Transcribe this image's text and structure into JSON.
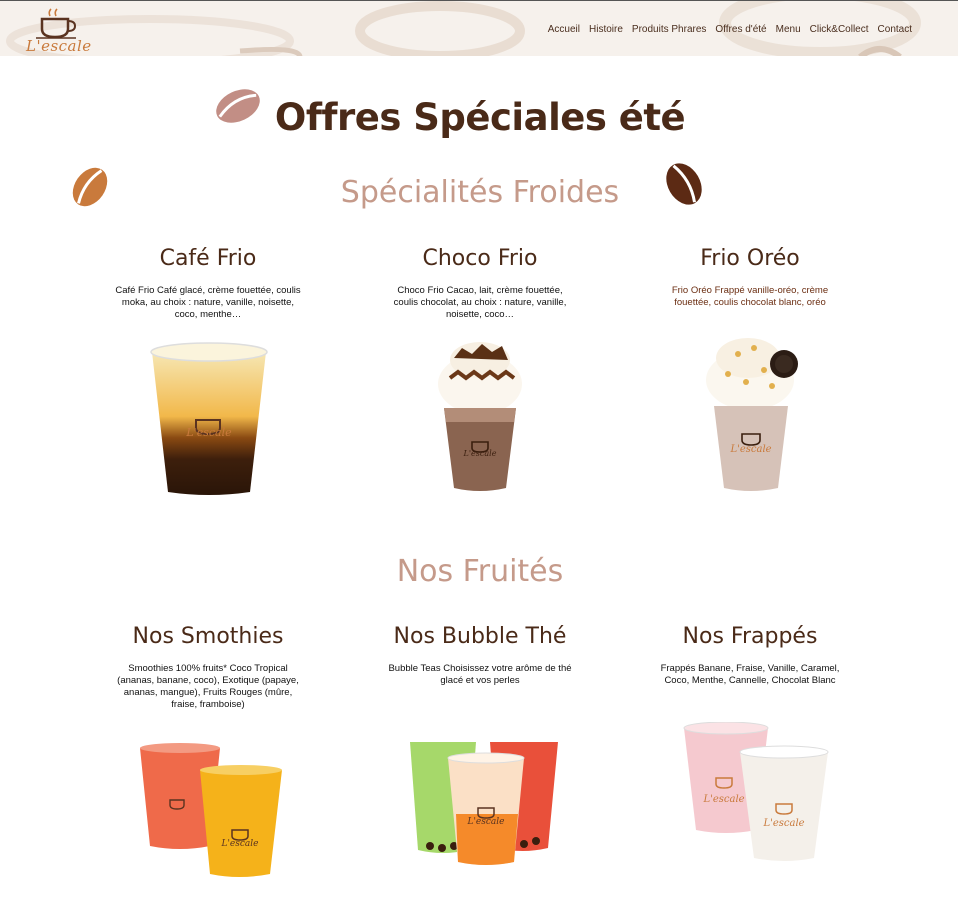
{
  "header": {
    "logo_text": "L'escale",
    "nav": [
      "Accueil",
      "Histoire",
      "Produits Phrares",
      "Offres d'été",
      "Menu",
      "Click&Collect",
      "Contact"
    ]
  },
  "page_title": "Offres Spéciales été",
  "sections": [
    {
      "title": "Spécialités Froides",
      "products": [
        {
          "name": "Café Frio",
          "desc": "Café Frio Café glacé, crème fouettée, coulis moka, au choix : nature, vanille, noisette, coco, menthe…"
        },
        {
          "name": "Choco Frio",
          "desc": "Choco Frio Cacao, lait, crème fouettée, coulis chocolat, au choix : nature, vanille, noisette, coco…"
        },
        {
          "name": "Frio Oréo",
          "desc": "Frio Oréo Frappé vanille-oréo, crème fouettée, coulis chocolat blanc, oréo"
        }
      ]
    },
    {
      "title": "Nos Fruités",
      "products": [
        {
          "name": "Nos Smothies",
          "desc": "Smoothies 100% fruits* Coco Tropical (ananas, banane, coco), Exotique (papaye, ananas, mangue), Fruits Rouges (mûre, fraise, framboise)"
        },
        {
          "name": "Nos Bubble Thé",
          "desc": "Bubble Teas Choisissez votre arôme de thé glacé et vos perles"
        },
        {
          "name": "Nos Frappés",
          "desc": "Frappés Banane, Fraise, Vanille, Caramel, Coco, Menthe, Cannelle, Chocolat Blanc"
        }
      ]
    }
  ],
  "colors": {
    "title_brown": "#4a2a18",
    "section_pink": "#c59a8a",
    "logo_orange": "#c97a3c",
    "header_bg": "#f6f1ec"
  }
}
